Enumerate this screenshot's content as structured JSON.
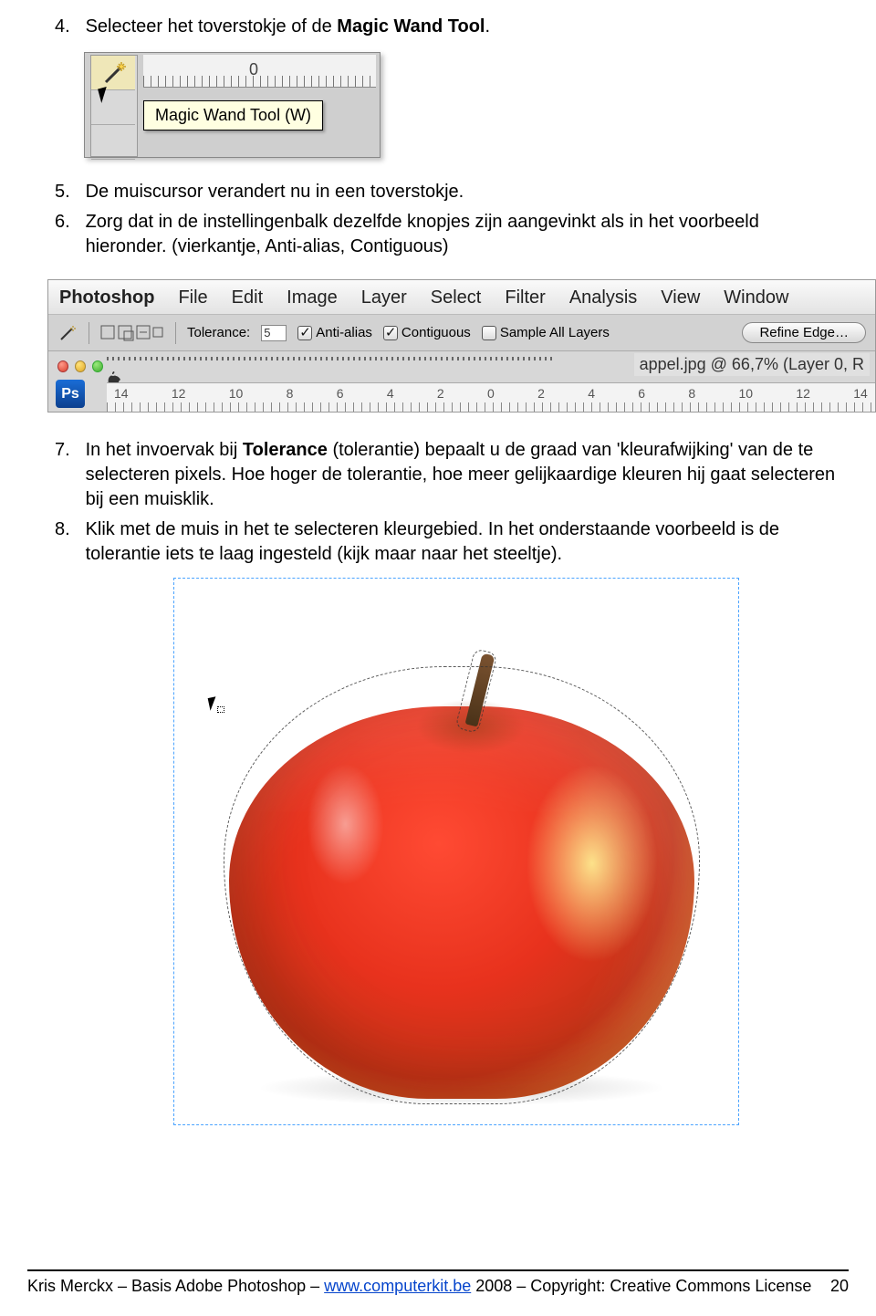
{
  "steps": {
    "s4": {
      "num": "4.",
      "pre": "Selecteer het toverstokje of de ",
      "bold": "Magic Wand Tool",
      "post": "."
    },
    "s5": {
      "num": "5.",
      "txt": "De muiscursor verandert nu in een toverstokje."
    },
    "s6": {
      "num": "6.",
      "txt": "Zorg dat in de instellingenbalk dezelfde knopjes zijn aangevinkt als in het voorbeeld hieronder. (vierkantje, Anti-alias, Contiguous)"
    },
    "s7": {
      "num": "7.",
      "pre": "In het invoervak bij ",
      "bold": "Tolerance",
      "post": " (tolerantie) bepaalt u de graad van 'kleurafwijking' van de te selecteren pixels. Hoe hoger de tolerantie, hoe meer gelijkaardige kleuren hij gaat selecteren bij een muisklik."
    },
    "s8": {
      "num": "8.",
      "txt": "Klik met de muis in het te selecteren kleurgebied. In het onderstaande voorbeeld is de tolerantie iets te laag ingesteld (kijk maar naar het steeltje)."
    }
  },
  "shot1": {
    "tooltip": "Magic Wand Tool (W)",
    "ruler_zero": "0"
  },
  "menubar": {
    "app": "Photoshop",
    "items": [
      "File",
      "Edit",
      "Image",
      "Layer",
      "Select",
      "Filter",
      "Analysis",
      "View",
      "Window"
    ]
  },
  "optbar": {
    "tolerance_label": "Tolerance:",
    "tolerance_value": "5",
    "anti_alias": "Anti-alias",
    "contiguous": "Contiguous",
    "sample_all": "Sample All Layers",
    "refine": "Refine Edge…"
  },
  "docrow": {
    "ps": "Ps",
    "title": "appel.jpg @ 66,7% (Layer 0, R",
    "ruler": [
      "14",
      "12",
      "10",
      "8",
      "6",
      "4",
      "2",
      "0",
      "2",
      "4",
      "6",
      "8",
      "10",
      "12",
      "14"
    ]
  },
  "footer": {
    "left_pre": "Kris Merckx – Basis Adobe Photoshop – ",
    "link": "www.computerkit.be",
    "left_post": " 2008 – Copyright: Creative Commons License",
    "page": "20"
  }
}
